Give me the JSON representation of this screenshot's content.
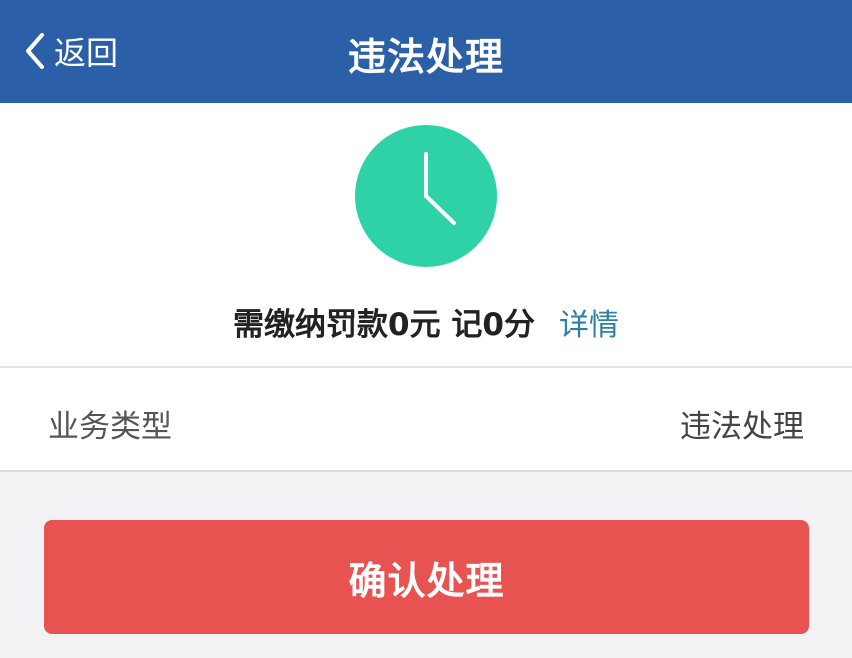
{
  "nav": {
    "back_label": "返回",
    "title": "违法处理"
  },
  "status": {
    "icon": "clock-icon",
    "icon_color": "#2fd2a7",
    "fine_summary": "需缴纳罚款0元 记0分",
    "details_link": "详情"
  },
  "info": {
    "label": "业务类型",
    "value": "违法处理"
  },
  "actions": {
    "confirm_label": "确认处理"
  },
  "colors": {
    "nav_bar": "#2b5fa8",
    "confirm_button": "#e85352",
    "link": "#2e7fa6"
  }
}
